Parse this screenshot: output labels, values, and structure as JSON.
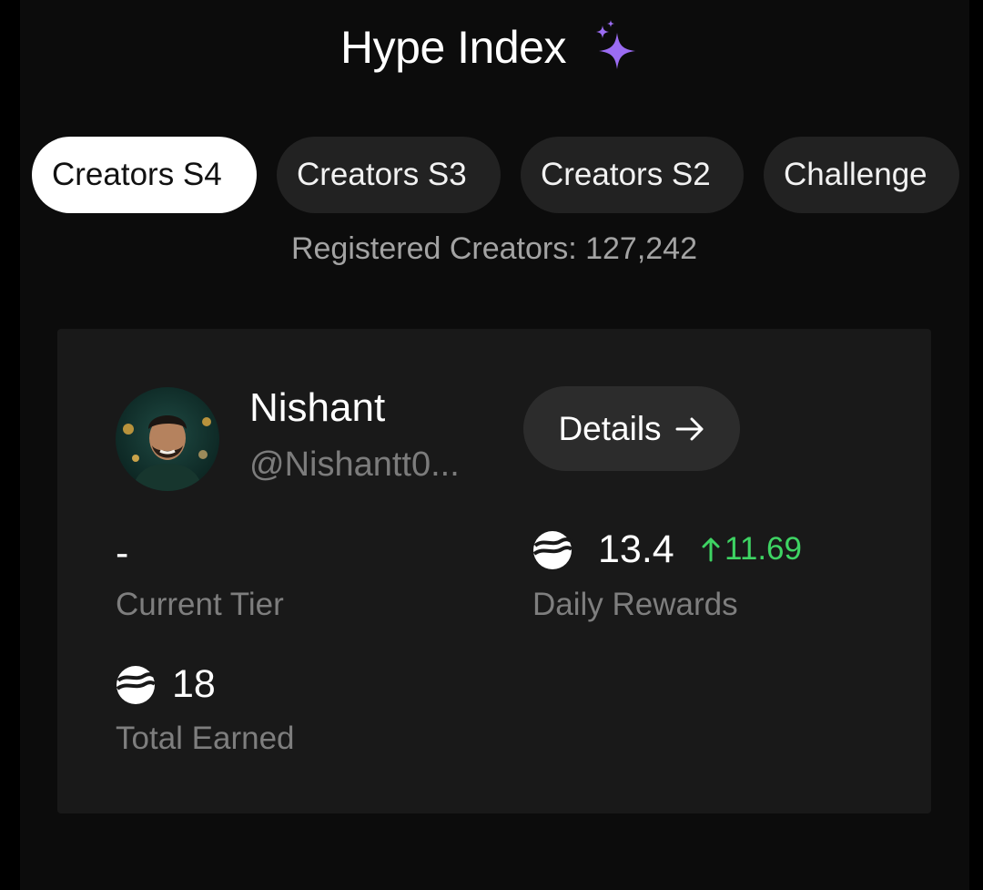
{
  "header": {
    "title": "Hype Index"
  },
  "tabs": [
    {
      "label": "Creators S4",
      "active": true
    },
    {
      "label": "Creators S3",
      "active": false
    },
    {
      "label": "Creators S2",
      "active": false
    },
    {
      "label": "Challenge",
      "active": false
    }
  ],
  "registered_text": "Registered Creators: 127,242",
  "profile": {
    "name": "Nishant",
    "handle": "@Nishantt0...",
    "details_label": "Details"
  },
  "stats": {
    "current_tier": {
      "value": "-",
      "label": "Current Tier"
    },
    "daily_rewards": {
      "value": "13.4",
      "delta": "11.69",
      "label": "Daily Rewards"
    },
    "total_earned": {
      "value": "18",
      "label": "Total Earned"
    }
  },
  "colors": {
    "background": "#000000",
    "panel": "#0c0c0c",
    "card": "#191919",
    "tab_inactive": "#222222",
    "tab_active": "#ffffff",
    "positive": "#3ed463",
    "sparkle": "#9b6cf2"
  },
  "icons": {
    "sparkle": "sparkle-icon",
    "arrow": "arrow-right-icon",
    "coin": "token-coin-icon",
    "delta": "arrow-up-icon"
  }
}
